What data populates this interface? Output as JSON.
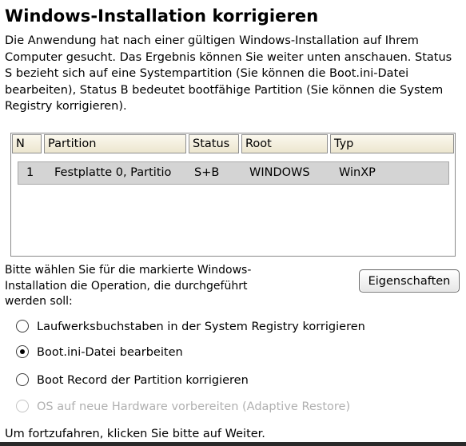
{
  "page": {
    "title": "Windows-Installation korrigieren",
    "intro": "Die Anwendung hat nach einer gültigen Windows-Installation auf Ihrem Computer gesucht. Das Ergebnis können Sie weiter unten anschauen. Status S bezieht sich auf eine Systempartition (Sie können die Boot.ini-Datei bearbeiten), Status B bedeutet bootfähige Partition (Sie können die System Registry korrigieren)."
  },
  "table": {
    "columns": [
      "N",
      "Partition",
      "Status",
      "Root",
      "Typ"
    ],
    "rows": [
      {
        "n": "1",
        "partition": "Festplatte 0, Partitio",
        "status": "S+B",
        "root": "WINDOWS",
        "typ": "WinXP"
      }
    ]
  },
  "operation": {
    "prompt": "Bitte wählen Sie für die markierte Windows-Installation die Operation, die durchgeführt werden soll:",
    "properties_button": "Eigenschaften",
    "options": [
      {
        "label": "Laufwerksbuchstaben in der System Registry korrigieren",
        "selected": false,
        "enabled": true
      },
      {
        "label": "Boot.ini-Datei bearbeiten",
        "selected": true,
        "enabled": true
      },
      {
        "label": "Boot Record der Partition korrigieren",
        "selected": false,
        "enabled": true
      },
      {
        "label": "OS auf neue Hardware vorbereiten (Adaptive Restore)",
        "selected": false,
        "enabled": false
      }
    ]
  },
  "footer": {
    "text": "Um fortzufahren, klicken Sie bitte auf Weiter."
  }
}
